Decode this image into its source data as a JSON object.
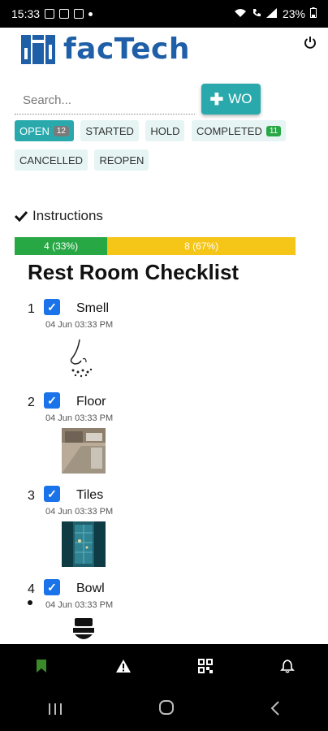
{
  "status_bar": {
    "time": "15:33",
    "battery": "23%"
  },
  "header": {
    "logo_text": "facTech"
  },
  "search": {
    "placeholder": "Search...",
    "value": ""
  },
  "actions": {
    "wo_label": "WO"
  },
  "filters": [
    {
      "label": "OPEN",
      "count": "12",
      "active": true
    },
    {
      "label": "STARTED"
    },
    {
      "label": "HOLD"
    },
    {
      "label": "COMPLETED",
      "count": "11"
    },
    {
      "label": "CANCELLED"
    },
    {
      "label": "REOPEN"
    }
  ],
  "instructions": {
    "label": "Instructions"
  },
  "progress": {
    "done_label": "4 (33%)",
    "done_fraction": 0.33,
    "remaining_label": "8 (67%)",
    "remaining_fraction": 0.67,
    "colors": {
      "done": "#28a745",
      "remaining": "#f5c518"
    }
  },
  "checklist": {
    "title": "Rest Room Checklist",
    "items": [
      {
        "num": "1",
        "label": "Smell",
        "time": "04 Jun 03:33 PM",
        "checked": true,
        "image": "nose-icon"
      },
      {
        "num": "2",
        "label": "Floor",
        "time": "04 Jun 03:33 PM",
        "checked": true,
        "image": "floor-photo"
      },
      {
        "num": "3",
        "label": "Tiles",
        "time": "04 Jun 03:33 PM",
        "checked": true,
        "image": "tiles-photo"
      },
      {
        "num": "4",
        "label": "Bowl",
        "time": "04 Jun 03:33 PM",
        "checked": true,
        "image": "toilet-bowl-icon"
      }
    ]
  },
  "bottom_nav": [
    "bookmark-icon",
    "warning-icon",
    "qr-code-icon",
    "bell-icon"
  ],
  "accent_color": "#2aa9ad"
}
